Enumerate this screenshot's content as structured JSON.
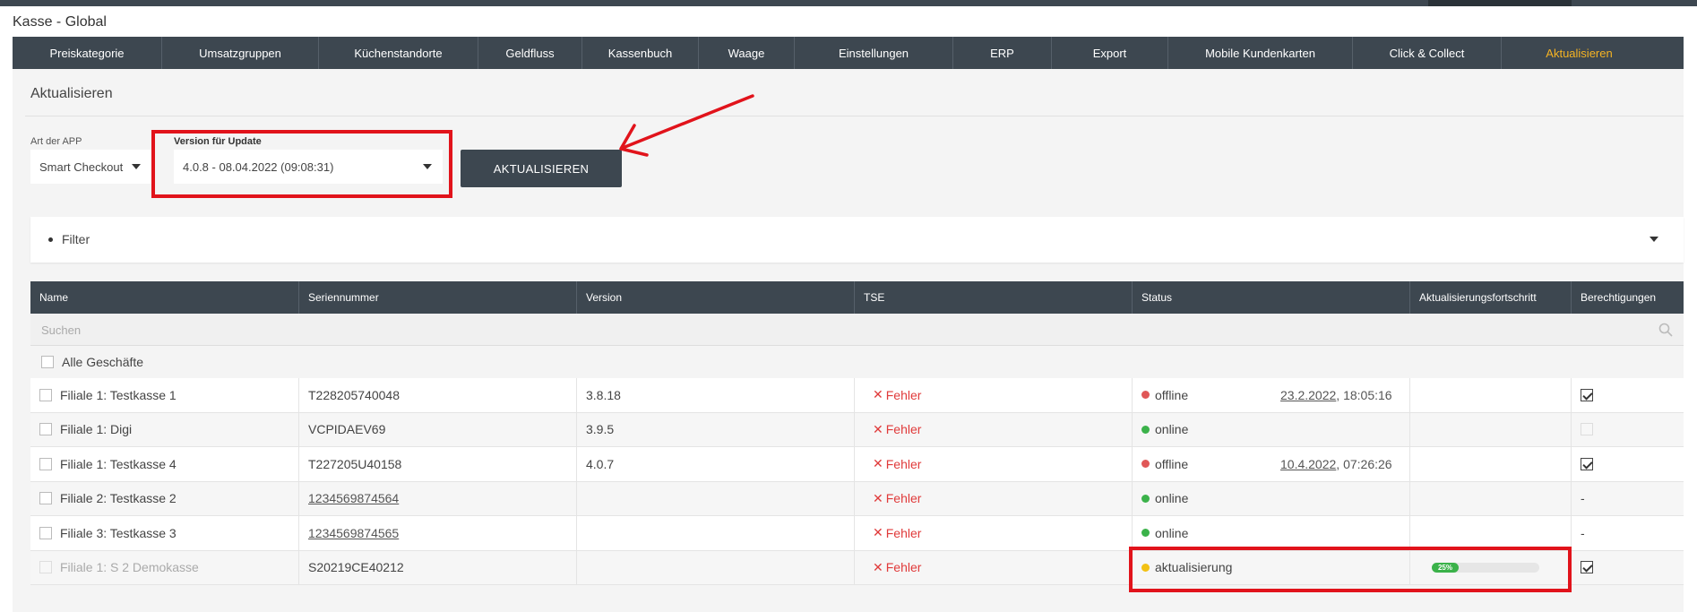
{
  "app": {
    "title": "Kasse - Global"
  },
  "nav": {
    "items": [
      {
        "label": "Preiskategorie",
        "active": false
      },
      {
        "label": "Umsatzgruppen",
        "active": false
      },
      {
        "label": "Küchenstandorte",
        "active": false
      },
      {
        "label": "Geldfluss",
        "active": false
      },
      {
        "label": "Kassenbuch",
        "active": false
      },
      {
        "label": "Waage",
        "active": false
      },
      {
        "label": "Einstellungen",
        "active": false
      },
      {
        "label": "ERP",
        "active": false
      },
      {
        "label": "Export",
        "active": false
      },
      {
        "label": "Mobile Kundenkarten",
        "active": false
      },
      {
        "label": "Click & Collect",
        "active": false
      },
      {
        "label": "Aktualisieren",
        "active": true
      }
    ]
  },
  "page": {
    "title": "Aktualisieren"
  },
  "form": {
    "app_type_label": "Art der APP",
    "app_type_value": "Smart Checkout",
    "version_label": "Version für Update",
    "version_value": "4.0.8 - 08.04.2022 (09:08:31)",
    "update_button": "AKTUALISIEREN"
  },
  "filter": {
    "label": "Filter"
  },
  "table": {
    "columns": [
      "Name",
      "Seriennummer",
      "Version",
      "TSE",
      "Status",
      "Aktualisierungsfortschritt",
      "Berechtigungen"
    ],
    "search_placeholder": "Suchen",
    "all_label": "Alle Geschäfte",
    "rows": [
      {
        "name": "Filiale 1: Testkasse 1",
        "serial": "T228205740048",
        "serial_link": false,
        "version": "3.8.18",
        "tse": "Fehler",
        "status": "offline",
        "status_color": "#e05757",
        "date": "23.2.2022",
        "time": ", 18:05:16",
        "progress": null,
        "perm": "checked",
        "disabled": false
      },
      {
        "name": "Filiale 1: Digi",
        "serial": "VCPIDAEV69",
        "serial_link": false,
        "version": "3.9.5",
        "tse": "Fehler",
        "status": "online",
        "status_color": "#3bb24a",
        "date": "",
        "time": "",
        "progress": null,
        "perm": "light",
        "disabled": false
      },
      {
        "name": "Filiale 1: Testkasse 4",
        "serial": "T227205U40158",
        "serial_link": false,
        "version": "4.0.7",
        "tse": "Fehler",
        "status": "offline",
        "status_color": "#e05757",
        "date": "10.4.2022",
        "time": ", 07:26:26",
        "progress": null,
        "perm": "checked",
        "disabled": false
      },
      {
        "name": "Filiale 2: Testkasse 2",
        "serial": "1234569874564",
        "serial_link": true,
        "version": "",
        "tse": "Fehler",
        "status": "online",
        "status_color": "#3bb24a",
        "date": "",
        "time": "",
        "progress": null,
        "perm": "-",
        "disabled": false
      },
      {
        "name": "Filiale 3: Testkasse 3",
        "serial": "1234569874565",
        "serial_link": true,
        "version": "",
        "tse": "Fehler",
        "status": "online",
        "status_color": "#3bb24a",
        "date": "",
        "time": "",
        "progress": null,
        "perm": "-",
        "disabled": false
      },
      {
        "name": "Filiale 1: S 2 Demokasse",
        "serial": "S20219CE40212",
        "serial_link": false,
        "version": "",
        "tse": "Fehler",
        "status": "aktualisierung",
        "status_color": "#f2c114",
        "date": "",
        "time": "",
        "progress": "25%",
        "progress_value": 0.25,
        "perm": "checked",
        "disabled": true
      }
    ]
  },
  "icons": {
    "search": "search-icon",
    "close": "close-icon",
    "caret": "chevron-down-icon"
  },
  "colors": {
    "header": "#3d4750",
    "accent": "#f5b323",
    "error": "#e03a3a",
    "annotation": "#e1131b"
  }
}
